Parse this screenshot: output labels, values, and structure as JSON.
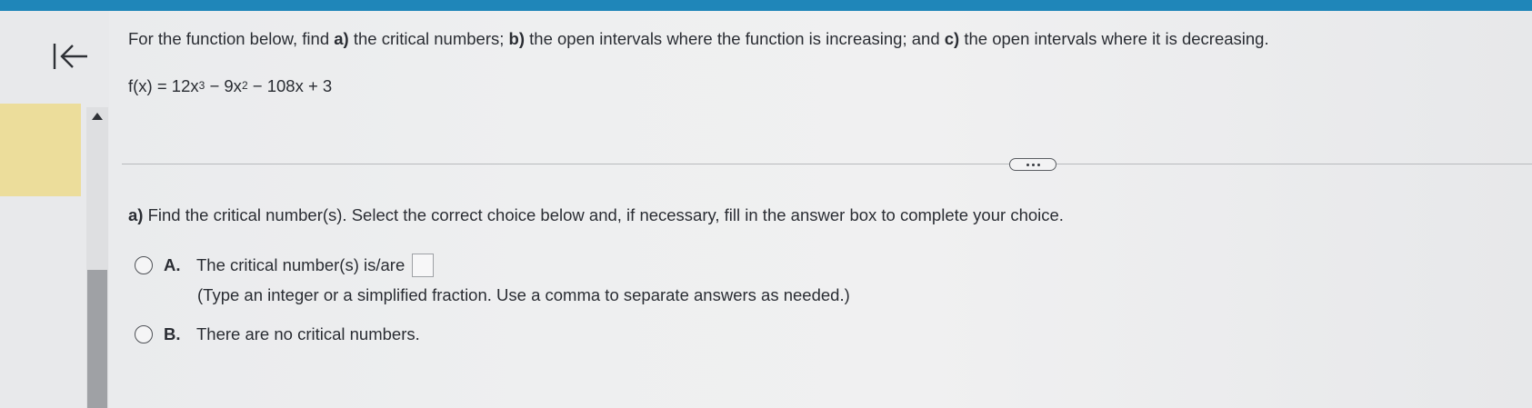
{
  "question": {
    "intro_1": "For the function below, find ",
    "a_bold": "a)",
    "intro_2": " the critical numbers; ",
    "b_bold": "b)",
    "intro_3": " the open intervals where the function is increasing; and ",
    "c_bold": "c)",
    "intro_4": " the open intervals where it is decreasing."
  },
  "function": {
    "prefix": "f(x) = 12x",
    "exp1": "3",
    "middle": " − 9x",
    "exp2": "2",
    "suffix": " − 108x + 3"
  },
  "part_a": {
    "label": "a)",
    "prompt": " Find the critical number(s). Select the correct choice below and, if necessary, fill in the answer box to complete your choice."
  },
  "choices": {
    "a": {
      "letter": "A.",
      "text": "The critical number(s) is/are",
      "answer_value": "",
      "hint": "(Type an integer or a simplified fraction. Use a comma to separate answers as needed.)"
    },
    "b": {
      "letter": "B.",
      "text": "There are no critical numbers."
    }
  },
  "icons": {
    "collapse": "collapse-left-icon",
    "scroll_up": "triangle-up-icon",
    "more": "more-dots-icon"
  },
  "colors": {
    "top_bar": "#1f86b9",
    "highlight_tab": "#ecdd9b"
  }
}
